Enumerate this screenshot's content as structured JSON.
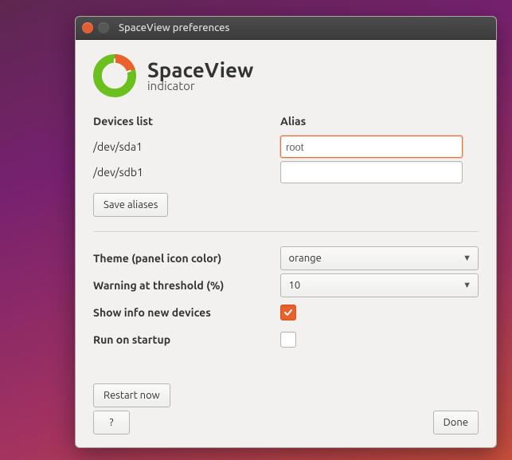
{
  "window": {
    "title": "SpaceView preferences"
  },
  "brand": {
    "name": "SpaceView",
    "subtitle": "indicator"
  },
  "devices": {
    "header": "Devices list",
    "alias_header": "Alias",
    "rows": [
      {
        "path": "/dev/sda1",
        "alias": "root",
        "focus": true
      },
      {
        "path": "/dev/sdb1",
        "alias": "",
        "focus": false
      }
    ],
    "save_label": "Save aliases"
  },
  "options": {
    "theme_label": "Theme (panel icon color)",
    "theme_value": "orange",
    "threshold_label": "Warning at threshold (%)",
    "threshold_value": "10",
    "show_new_label": "Show info new devices",
    "show_new_checked": true,
    "startup_label": "Run on startup",
    "startup_checked": false
  },
  "footer": {
    "restart_label": "Restart now",
    "help_label": "?",
    "done_label": "Done"
  }
}
